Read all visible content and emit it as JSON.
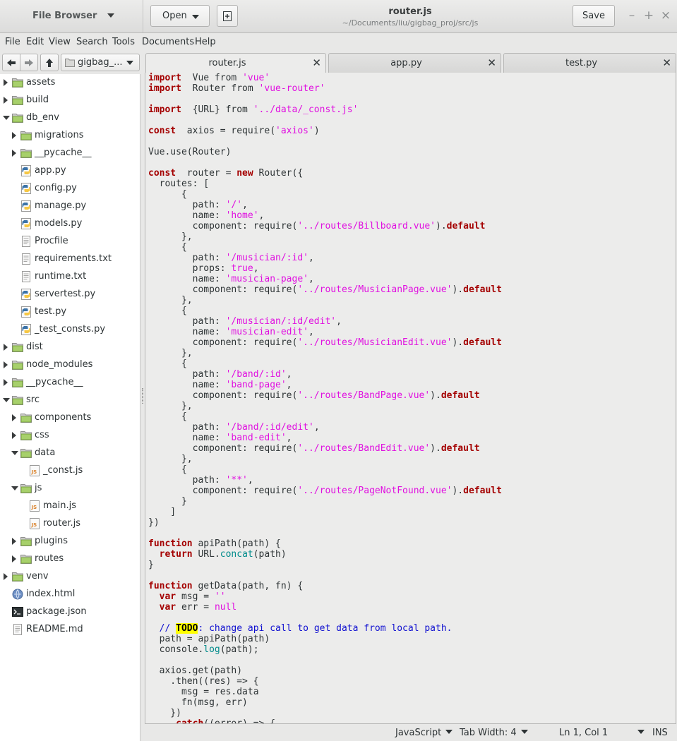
{
  "sidebar_header": {
    "title": "File Browser"
  },
  "toolbar": {
    "open_label": "Open",
    "save_label": "Save",
    "new_document_icon": "new-document-icon"
  },
  "window": {
    "title": "router.js",
    "subtitle": "~/Documents/liu/gigbag_proj/src/js",
    "minimize": "–",
    "maximize": "+",
    "close": "×"
  },
  "menu": [
    "File",
    "Edit",
    "View",
    "Search",
    "Tools",
    "Documents",
    "Help"
  ],
  "file_browser": {
    "location": "gigbag_...",
    "items": [
      {
        "label": "assets",
        "type": "folder",
        "state": "collapsed",
        "depth": 0
      },
      {
        "label": "build",
        "type": "folder",
        "state": "collapsed",
        "depth": 0
      },
      {
        "label": "db_env",
        "type": "folder",
        "state": "expanded",
        "depth": 0
      },
      {
        "label": "migrations",
        "type": "folder",
        "state": "collapsed",
        "depth": 1
      },
      {
        "label": "__pycache__",
        "type": "folder",
        "state": "collapsed",
        "depth": 1
      },
      {
        "label": "app.py",
        "type": "python",
        "depth": 1
      },
      {
        "label": "config.py",
        "type": "python",
        "depth": 1
      },
      {
        "label": "manage.py",
        "type": "python",
        "depth": 1
      },
      {
        "label": "models.py",
        "type": "python",
        "depth": 1
      },
      {
        "label": "Procfile",
        "type": "text",
        "depth": 1
      },
      {
        "label": "requirements.txt",
        "type": "text",
        "depth": 1
      },
      {
        "label": "runtime.txt",
        "type": "text",
        "depth": 1
      },
      {
        "label": "servertest.py",
        "type": "python",
        "depth": 1
      },
      {
        "label": "test.py",
        "type": "python",
        "depth": 1
      },
      {
        "label": "_test_consts.py",
        "type": "python",
        "depth": 1
      },
      {
        "label": "dist",
        "type": "folder",
        "state": "collapsed",
        "depth": 0
      },
      {
        "label": "node_modules",
        "type": "folder",
        "state": "collapsed",
        "depth": 0
      },
      {
        "label": "__pycache__",
        "type": "folder",
        "state": "collapsed",
        "depth": 0
      },
      {
        "label": "src",
        "type": "folder",
        "state": "expanded",
        "depth": 0
      },
      {
        "label": "components",
        "type": "folder",
        "state": "collapsed",
        "depth": 1
      },
      {
        "label": "css",
        "type": "folder",
        "state": "collapsed",
        "depth": 1
      },
      {
        "label": "data",
        "type": "folder",
        "state": "expanded",
        "depth": 1
      },
      {
        "label": "_const.js",
        "type": "js",
        "depth": 2
      },
      {
        "label": "js",
        "type": "folder",
        "state": "expanded",
        "depth": 1
      },
      {
        "label": "main.js",
        "type": "js",
        "depth": 2
      },
      {
        "label": "router.js",
        "type": "js",
        "depth": 2
      },
      {
        "label": "plugins",
        "type": "folder",
        "state": "collapsed",
        "depth": 1
      },
      {
        "label": "routes",
        "type": "folder",
        "state": "collapsed",
        "depth": 1
      },
      {
        "label": "venv",
        "type": "folder",
        "state": "collapsed",
        "depth": 0
      },
      {
        "label": "index.html",
        "type": "html",
        "depth": 0
      },
      {
        "label": "package.json",
        "type": "json",
        "depth": 0
      },
      {
        "label": "README.md",
        "type": "text",
        "depth": 0
      }
    ]
  },
  "tabs": [
    {
      "label": "router.js",
      "active": true
    },
    {
      "label": "app.py",
      "active": false
    },
    {
      "label": "test.py",
      "active": false
    }
  ],
  "editor": {
    "lines": [
      [
        [
          "kw",
          "import"
        ],
        [
          "",
          "  Vue from "
        ],
        [
          "st",
          "'vue'"
        ]
      ],
      [
        [
          "kw",
          "import"
        ],
        [
          "",
          "  Router from "
        ],
        [
          "st",
          "'vue-router'"
        ]
      ],
      [],
      [
        [
          "kw",
          "import"
        ],
        [
          "",
          "  {URL} from "
        ],
        [
          "st",
          "'../data/_const.js'"
        ]
      ],
      [],
      [
        [
          "kw",
          "const"
        ],
        [
          "",
          "  axios = require("
        ],
        [
          "st",
          "'axios'"
        ],
        [
          "",
          ")"
        ]
      ],
      [],
      [
        [
          "",
          "Vue.use(Router)"
        ]
      ],
      [],
      [
        [
          "kw",
          "const"
        ],
        [
          "",
          "  router = "
        ],
        [
          "kw",
          "new"
        ],
        [
          "",
          " Router({"
        ]
      ],
      [
        [
          "",
          "  routes: ["
        ]
      ],
      [
        [
          "",
          "      {"
        ]
      ],
      [
        [
          "",
          "        path: "
        ],
        [
          "st",
          "'/'"
        ],
        [
          "",
          ","
        ]
      ],
      [
        [
          "",
          "        name: "
        ],
        [
          "st",
          "'home'"
        ],
        [
          "",
          ","
        ]
      ],
      [
        [
          "",
          "        component: require("
        ],
        [
          "st",
          "'../routes/Billboard.vue'"
        ],
        [
          "",
          ")."
        ],
        [
          "kw",
          "default"
        ]
      ],
      [
        [
          "",
          "      },"
        ]
      ],
      [
        [
          "",
          "      {"
        ]
      ],
      [
        [
          "",
          "        path: "
        ],
        [
          "st",
          "'/musician/:id'"
        ],
        [
          "",
          ","
        ]
      ],
      [
        [
          "",
          "        props: "
        ],
        [
          "st",
          "true"
        ],
        [
          "",
          ","
        ]
      ],
      [
        [
          "",
          "        name: "
        ],
        [
          "st",
          "'musician-page'"
        ],
        [
          "",
          ","
        ]
      ],
      [
        [
          "",
          "        component: require("
        ],
        [
          "st",
          "'../routes/MusicianPage.vue'"
        ],
        [
          "",
          ")."
        ],
        [
          "kw",
          "default"
        ]
      ],
      [
        [
          "",
          "      },"
        ]
      ],
      [
        [
          "",
          "      {"
        ]
      ],
      [
        [
          "",
          "        path: "
        ],
        [
          "st",
          "'/musician/:id/edit'"
        ],
        [
          "",
          ","
        ]
      ],
      [
        [
          "",
          "        name: "
        ],
        [
          "st",
          "'musician-edit'"
        ],
        [
          "",
          ","
        ]
      ],
      [
        [
          "",
          "        component: require("
        ],
        [
          "st",
          "'../routes/MusicianEdit.vue'"
        ],
        [
          "",
          ")."
        ],
        [
          "kw",
          "default"
        ]
      ],
      [
        [
          "",
          "      },"
        ]
      ],
      [
        [
          "",
          "      {"
        ]
      ],
      [
        [
          "",
          "        path: "
        ],
        [
          "st",
          "'/band/:id'"
        ],
        [
          "",
          ","
        ]
      ],
      [
        [
          "",
          "        name: "
        ],
        [
          "st",
          "'band-page'"
        ],
        [
          "",
          ","
        ]
      ],
      [
        [
          "",
          "        component: require("
        ],
        [
          "st",
          "'../routes/BandPage.vue'"
        ],
        [
          "",
          ")."
        ],
        [
          "kw",
          "default"
        ]
      ],
      [
        [
          "",
          "      },"
        ]
      ],
      [
        [
          "",
          "      {"
        ]
      ],
      [
        [
          "",
          "        path: "
        ],
        [
          "st",
          "'/band/:id/edit'"
        ],
        [
          "",
          ","
        ]
      ],
      [
        [
          "",
          "        name: "
        ],
        [
          "st",
          "'band-edit'"
        ],
        [
          "",
          ","
        ]
      ],
      [
        [
          "",
          "        component: require("
        ],
        [
          "st",
          "'../routes/BandEdit.vue'"
        ],
        [
          "",
          ")."
        ],
        [
          "kw",
          "default"
        ]
      ],
      [
        [
          "",
          "      },"
        ]
      ],
      [
        [
          "",
          "      {"
        ]
      ],
      [
        [
          "",
          "        path: "
        ],
        [
          "st",
          "'**'"
        ],
        [
          "",
          ","
        ]
      ],
      [
        [
          "",
          "        component: require("
        ],
        [
          "st",
          "'../routes/PageNotFound.vue'"
        ],
        [
          "",
          ")."
        ],
        [
          "kw",
          "default"
        ]
      ],
      [
        [
          "",
          "      }"
        ]
      ],
      [
        [
          "",
          "    ]"
        ]
      ],
      [
        [
          "",
          "})"
        ]
      ],
      [],
      [
        [
          "kw",
          "function"
        ],
        [
          "",
          " apiPath(path) {"
        ]
      ],
      [
        [
          "",
          "  "
        ],
        [
          "kw",
          "return"
        ],
        [
          "",
          " URL."
        ],
        [
          "fn",
          "concat"
        ],
        [
          "",
          "(path)"
        ]
      ],
      [
        [
          "",
          "}"
        ]
      ],
      [],
      [
        [
          "kw",
          "function"
        ],
        [
          "",
          " getData(path, fn) {"
        ]
      ],
      [
        [
          "",
          "  "
        ],
        [
          "kw",
          "var"
        ],
        [
          "",
          " msg = "
        ],
        [
          "st",
          "''"
        ]
      ],
      [
        [
          "",
          "  "
        ],
        [
          "kw",
          "var"
        ],
        [
          "",
          " err = "
        ],
        [
          "st",
          "null"
        ]
      ],
      [],
      [
        [
          "",
          "  "
        ],
        [
          "cm",
          "// "
        ],
        [
          "todo",
          "TODO"
        ],
        [
          "cm",
          ": change api call to get data from local path."
        ]
      ],
      [
        [
          "",
          "  path = apiPath(path)"
        ]
      ],
      [
        [
          "",
          "  console."
        ],
        [
          "fn",
          "log"
        ],
        [
          "",
          "(path);"
        ]
      ],
      [],
      [
        [
          "",
          "  axios.get(path)"
        ]
      ],
      [
        [
          "",
          "    .then((res) => {"
        ]
      ],
      [
        [
          "",
          "      msg = res.data"
        ]
      ],
      [
        [
          "",
          "      fn(msg, err)"
        ]
      ],
      [
        [
          "",
          "    })"
        ]
      ],
      [
        [
          "",
          "    "
        ],
        [
          "kw",
          ".catch"
        ],
        [
          "",
          "((error) => {"
        ]
      ]
    ]
  },
  "statusbar": {
    "language": "JavaScript",
    "tab_width": "Tab Width: 4",
    "position": "Ln 1, Col 1",
    "mode": "INS"
  }
}
